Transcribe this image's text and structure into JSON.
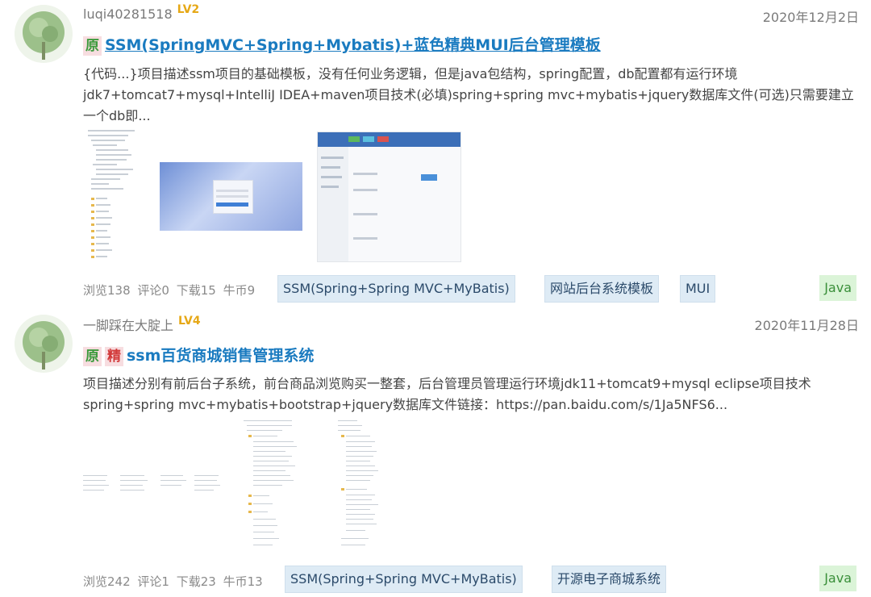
{
  "posts": [
    {
      "user": "luqi40281518",
      "level": "LV2",
      "date": "2020年12月2日",
      "badges": [
        "原"
      ],
      "title": "SSM(SpringMVC+Spring+Mybatis)+蓝色精典MUI后台管理模板",
      "description": "{代码...}项目描述ssm项目的基础模板，没有任何业务逻辑，但是java包结构，spring配置，db配置都有运行环境jdk7+tomcat7+mysql+IntelliJ IDEA+maven项目技术(必填)spring+spring mvc+mybatis+jquery数据库文件(可选)只需要建立一个db即...",
      "stats": {
        "views": "浏览138",
        "comments": "评论0",
        "downloads": "下载15",
        "coins": "牛币9"
      },
      "tags": [
        "SSM(Spring+Spring MVC+MyBatis)",
        "网站后台系统模板",
        "MUI"
      ],
      "language": "Java",
      "thumbnails": [
        "file-tree-screenshot",
        "login-page-screenshot",
        "admin-panel-screenshot"
      ]
    },
    {
      "user": "一脚踩在大腚上",
      "level": "LV4",
      "date": "2020年11月28日",
      "badges": [
        "原",
        "精"
      ],
      "title": "ssm百货商城销售管理系统",
      "description": "项目描述分别有前后台子系统，前台商品浏览购买一整套，后台管理员管理运行环境jdk11+tomcat9+mysql eclipse项目技术spring+spring mvc+mybatis+bootstrap+jquery数据库文件链接：https://pan.baidu.com/s/1Ja5NFS6...",
      "stats": {
        "views": "浏览242",
        "comments": "评论1",
        "downloads": "下载23",
        "coins": "牛币13"
      },
      "tags": [
        "SSM(Spring+Spring MVC+MyBatis)",
        "开源电子商城系统"
      ],
      "language": "Java",
      "thumbnails": [
        "directory-listing-screenshot",
        "project-tree-screenshot",
        "package-tree-screenshot"
      ]
    }
  ],
  "colors": {
    "title": "#1a7bc0",
    "level": "#e6a817",
    "tag_bg": "#deebf5",
    "lang_bg": "#dbf4d8",
    "badge_bg": "#f7dde0"
  }
}
